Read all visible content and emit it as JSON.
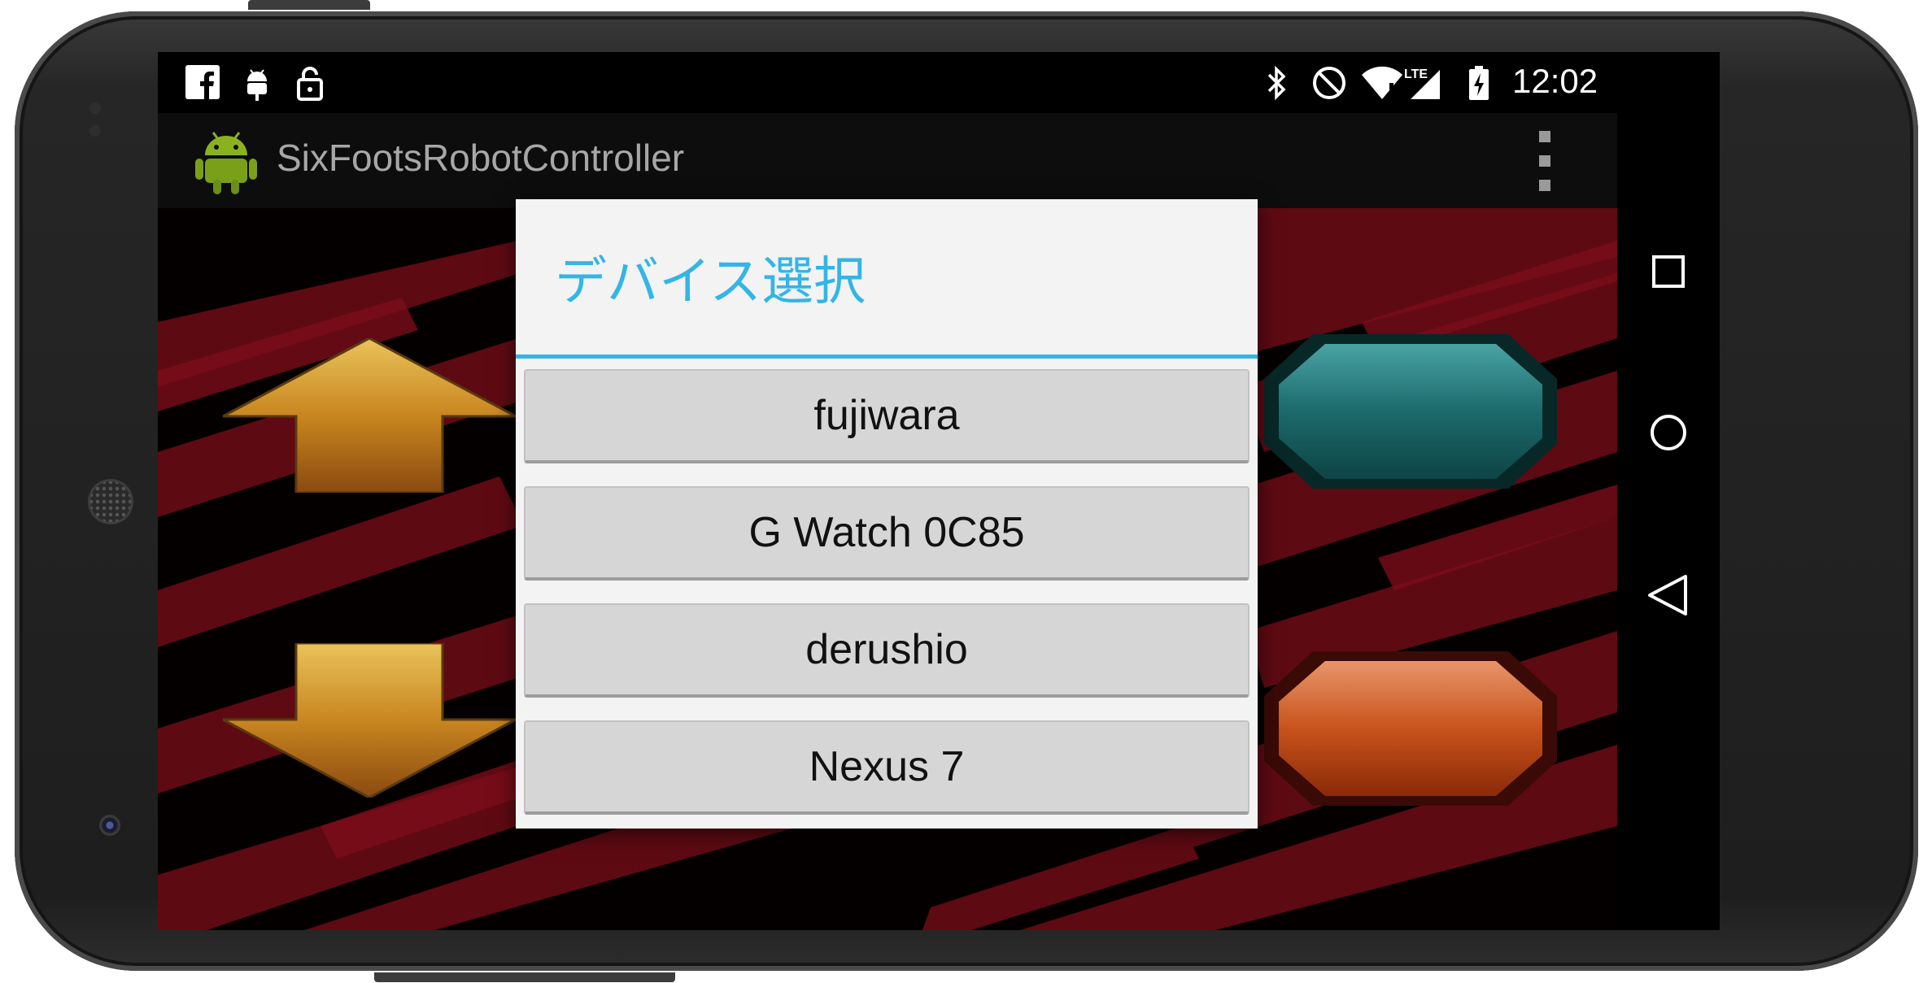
{
  "status_bar": {
    "time": "12:02",
    "left_icons": [
      "facebook-icon",
      "android-debug-icon",
      "lock-icon"
    ],
    "right_icons": [
      "bluetooth-icon",
      "do-not-disturb-icon",
      "wifi-icon",
      "lte-signal-icon",
      "battery-charging-icon"
    ],
    "signal_label": "LTE"
  },
  "action_bar": {
    "title": "SixFootsRobotController",
    "logo": "android-robot-icon",
    "menu_icon": "overflow-menu-icon"
  },
  "dialog": {
    "title": "デバイス選択",
    "items": [
      {
        "label": "fujiwara"
      },
      {
        "label": "G Watch 0C85"
      },
      {
        "label": "derushio"
      },
      {
        "label": "Nexus 7"
      }
    ],
    "accent_color": "#33b5e5"
  },
  "controls": {
    "up_arrow": "forward-arrow-icon",
    "down_arrow": "backward-arrow-icon",
    "teal_button": "teal-octagon-button",
    "orange_button": "orange-octagon-button"
  },
  "nav_bar": {
    "buttons": [
      "recents-icon",
      "home-icon",
      "back-icon"
    ]
  },
  "colors": {
    "background_stripe": "#6b0a14",
    "teal": "#1f7a7a",
    "orange": "#c8531c",
    "arrow_gold": "#d89a2a"
  }
}
